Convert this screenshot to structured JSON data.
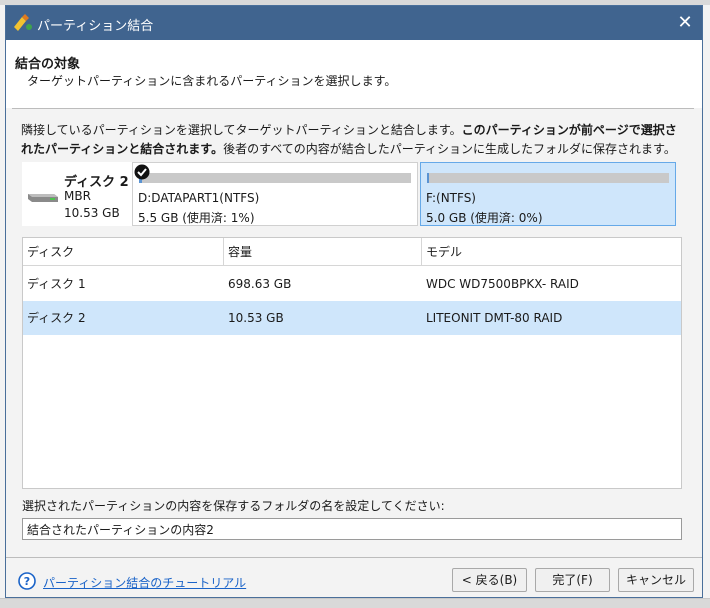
{
  "window": {
    "title": "パーティション結合",
    "close_glyph": "✕"
  },
  "header": {
    "title": "結合の対象",
    "subtitle": "ターゲットパーティションに含まれるパーティションを選択します。"
  },
  "description": {
    "part1": "隣接しているパーティションを選択してターゲットパーティションと結合します。",
    "bold": "このパーティションが前ページで選択されたパーティションと結合されます。",
    "part2": "後者のすべての内容が結合したパーティションに生成したフォルダに保存されます。"
  },
  "disk_map": {
    "disk_name": "ディスク 2",
    "disk_type": "MBR",
    "disk_size": "10.53 GB",
    "partitions": [
      {
        "name": "D:DATAPART1(NTFS)",
        "usage": "5.5 GB (使用済: 1%)",
        "used_fraction": 0.01,
        "checked": true,
        "selected": false
      },
      {
        "name": "F:(NTFS)",
        "usage": "5.0 GB (使用済: 0%)",
        "used_fraction": 0.0,
        "checked": false,
        "selected": true
      }
    ]
  },
  "table": {
    "headers": [
      "ディスク",
      "容量",
      "モデル"
    ],
    "rows": [
      [
        "ディスク 1",
        "698.63 GB",
        "WDC WD7500BPKX- RAID"
      ],
      [
        "ディスク 2",
        "10.53 GB",
        "LITEONIT DMT-80 RAID"
      ]
    ],
    "selected_row": 1
  },
  "folder": {
    "label": "選択されたパーティションの内容を保存するフォルダの名を設定してください:",
    "value": "結合されたパーティションの内容2"
  },
  "footer": {
    "help_link": "パーティション結合のチュートリアル",
    "back_label": "< 戻る(B)",
    "finish_label": "完了(F)",
    "cancel_label": "キャンセル"
  },
  "colors": {
    "titlebar": "#40648f",
    "selection": "#cfe6fb",
    "link": "#1a63c8",
    "usage_fill": "#5a93d2"
  }
}
